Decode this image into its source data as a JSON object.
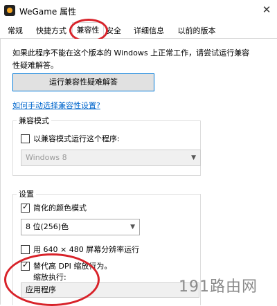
{
  "window": {
    "title": "WeGame 属性",
    "close_glyph": "✕"
  },
  "tabs": [
    {
      "label": "常规"
    },
    {
      "label": "快捷方式"
    },
    {
      "label": "兼容性"
    },
    {
      "label": "安全"
    },
    {
      "label": "详细信息"
    },
    {
      "label": "以前的版本"
    }
  ],
  "intro": {
    "line1": "如果此程序不能在这个版本的 Windows 上正常工作，请尝试运行兼容",
    "line2": "性疑难解答。"
  },
  "troubleshooter_button": "运行兼容性疑难解答",
  "manual_link": "如何手动选择兼容性设置?",
  "compat_mode": {
    "legend": "兼容模式",
    "checkbox_label": "以兼容模式运行这个程序:",
    "os_selected": "Windows 8"
  },
  "settings": {
    "legend": "设置",
    "reduced_color_label": "简化的颜色模式",
    "color_selected": "8 位(256)色",
    "res640_label": "用 640 × 480 屏幕分辨率运行",
    "dpi_label": "替代高 DPI 缩放行为。",
    "scale_label": "缩放执行:",
    "scale_selected": "应用程序"
  },
  "watermark": "191路由网",
  "accent": {
    "annotation_red": "#d8232a",
    "link_blue": "#0066cc"
  }
}
